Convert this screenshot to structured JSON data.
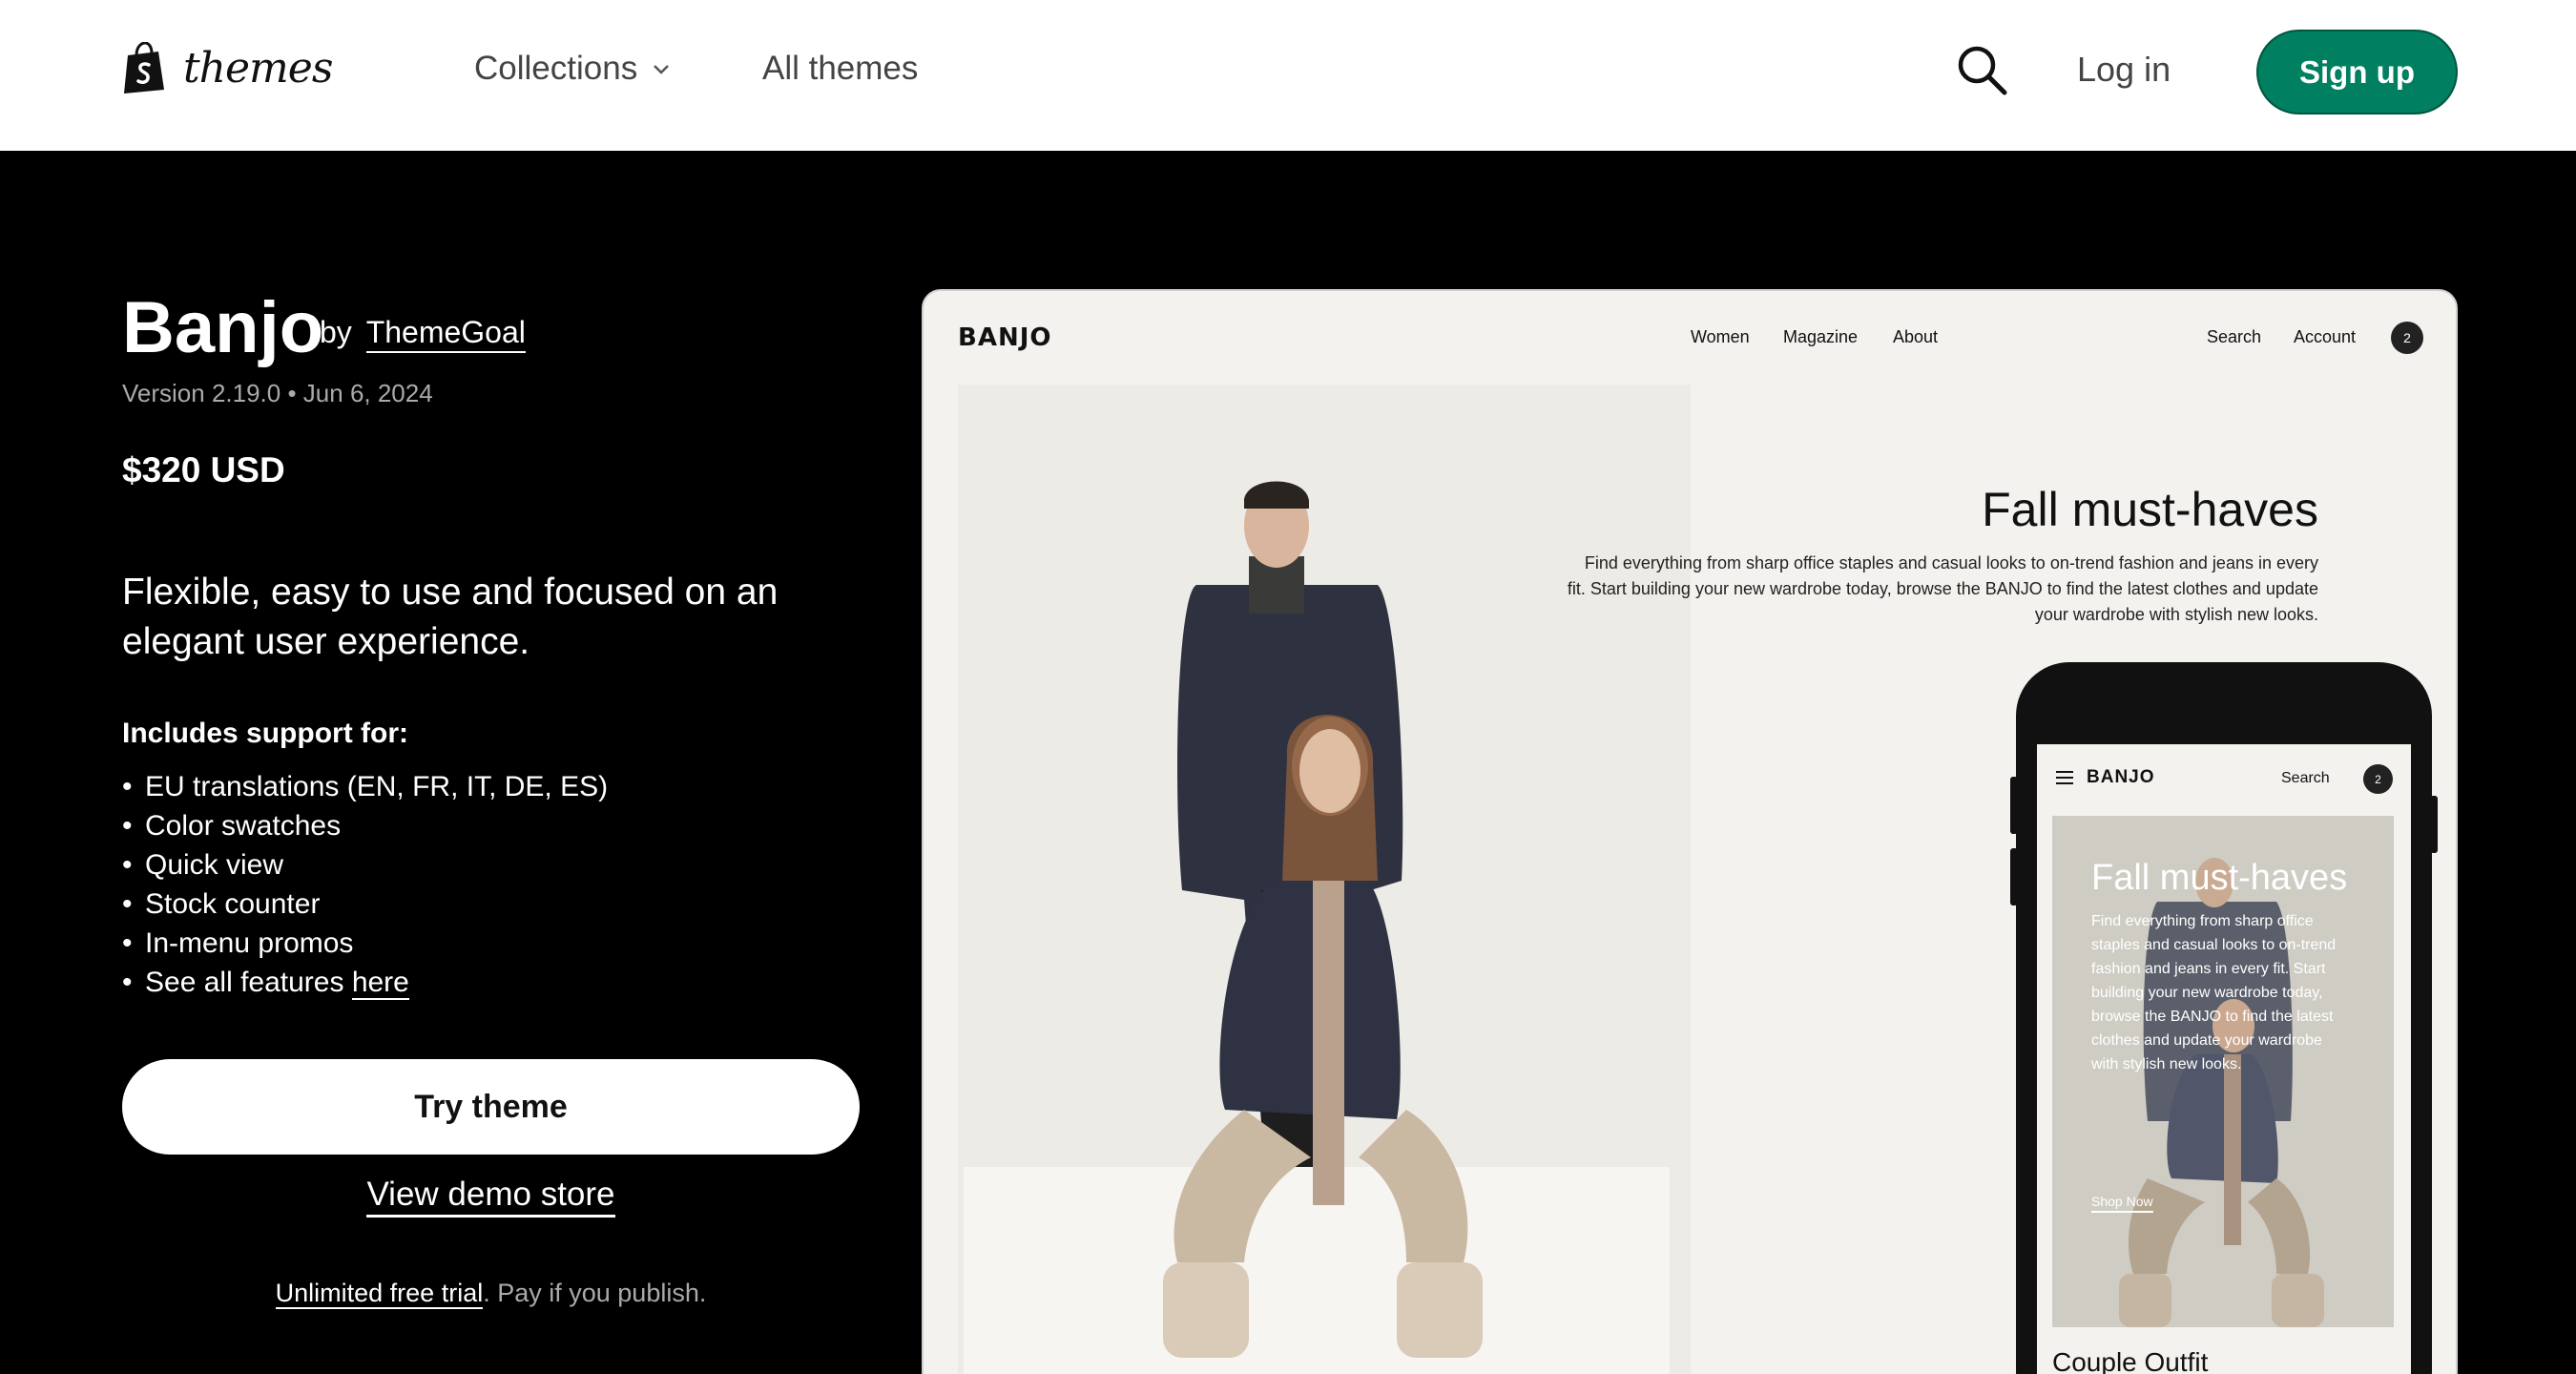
{
  "nav": {
    "logo_text": "themes",
    "collections": "Collections",
    "all_themes": "All themes",
    "login": "Log in",
    "signup": "Sign up"
  },
  "theme": {
    "name": "Banjo",
    "by_label": "by",
    "author": "ThemeGoal",
    "version": "Version 2.19.0",
    "date": "Jun 6, 2024",
    "price": "$320 USD",
    "tagline": "Flexible, easy to use and focused on an elegant user experience.",
    "support_heading": "Includes support for:",
    "features": [
      "EU translations (EN, FR, IT, DE, ES)",
      "Color swatches",
      "Quick view",
      "Stock counter",
      "In-menu promos"
    ],
    "see_all_prefix": "See all features",
    "see_all_link": "here",
    "try_label": "Try theme",
    "demo_label": "View demo store",
    "trial_link": "Unlimited free trial",
    "trial_rest": ". Pay if you publish."
  },
  "preview": {
    "logo": "BANJO",
    "menu": [
      "Women",
      "Magazine",
      "About"
    ],
    "search": "Search",
    "account": "Account",
    "cart_count": "2",
    "heading": "Fall must-haves",
    "description": "Find everything from sharp office staples and casual looks to on-trend fashion and jeans in every fit. Start building your new wardrobe today, browse the BANJO to find the latest clothes and update your wardrobe with stylish new looks.",
    "mobile": {
      "logo": "BANJO",
      "search": "Search",
      "cart_count": "2",
      "heading": "Fall must-haves",
      "description": "Find everything from sharp office staples and casual looks to on-trend fashion and jeans in every fit. Start building your new wardrobe today, browse the BANJO to find the latest clothes and update your wardrobe with stylish new looks.",
      "cta": "Shop Now",
      "caption": "Couple Outfit"
    }
  },
  "colors": {
    "accent": "#008060",
    "background": "#000000",
    "preview_bg": "#f3f2ee"
  }
}
